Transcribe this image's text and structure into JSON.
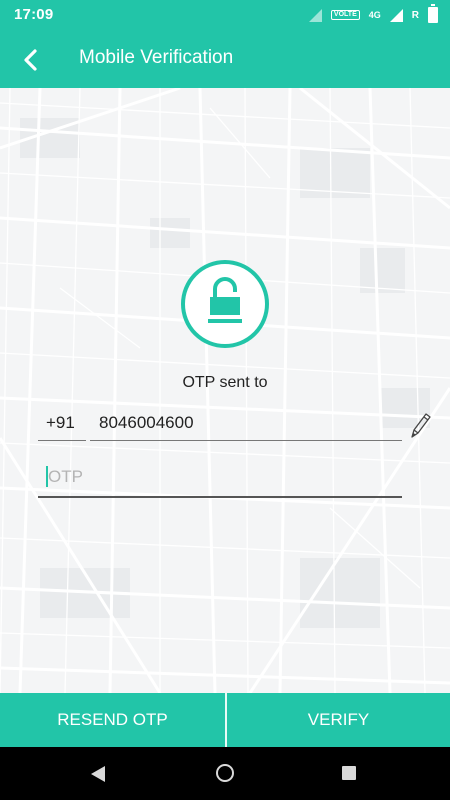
{
  "status_bar": {
    "time": "17:09",
    "volte_label": "VOLTE",
    "network_label": "4G",
    "roaming_label": "R"
  },
  "app_bar": {
    "title": "Mobile Verification",
    "back_icon": "chevron-left-icon"
  },
  "verification": {
    "lock_icon": "lock-icon",
    "otp_sent_label": "OTP sent to",
    "country_code": "+91",
    "phone_number": "8046004600",
    "edit_icon": "pencil-icon",
    "otp_placeholder": "OTP",
    "otp_value": ""
  },
  "actions": {
    "resend_label": "RESEND OTP",
    "verify_label": "VERIFY"
  },
  "navigation": {
    "back_icon": "nav-back-icon",
    "home_icon": "nav-home-icon",
    "recents_icon": "nav-recents-icon"
  },
  "colors": {
    "accent": "#22c5a8",
    "map_background": "#f4f5f6",
    "nav_bar": "#000000"
  }
}
